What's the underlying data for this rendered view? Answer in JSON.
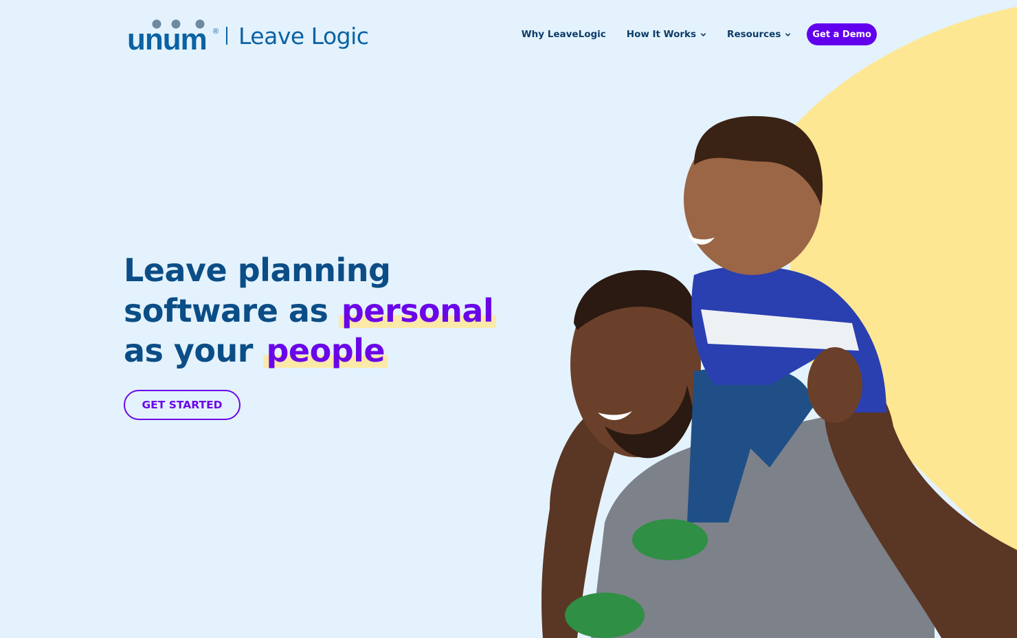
{
  "brand": {
    "logo_word": "unum",
    "logo_reg": "®",
    "product_name": "Leave Logic"
  },
  "nav": {
    "items": [
      {
        "label": "Why LeaveLogic",
        "has_dropdown": false
      },
      {
        "label": "How It Works",
        "has_dropdown": true
      },
      {
        "label": "Resources",
        "has_dropdown": true
      }
    ],
    "cta_label": "Get a Demo"
  },
  "hero": {
    "line1": "Leave planning",
    "line2_prefix": "software as",
    "line2_highlight": "personal",
    "line3_prefix": "as your",
    "line3_highlight": "people",
    "cta_label": "GET STARTED"
  },
  "image": {
    "description": "photo-father-carrying-smiling-son-on-shoulders"
  },
  "colors": {
    "background": "#e3f2fc",
    "brand_blue": "#0b62a4",
    "heading_blue": "#0b4d86",
    "accent_purple": "#6a06e8",
    "highlight_yellow": "#fbe9a8",
    "blob_yellow": "#fde792"
  }
}
